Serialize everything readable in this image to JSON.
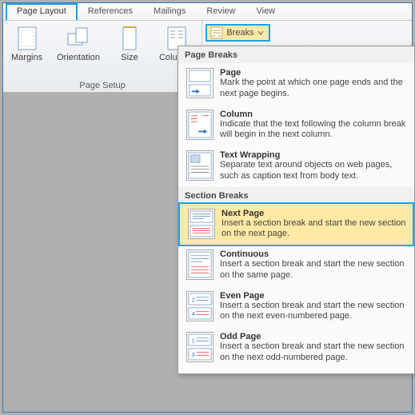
{
  "tabs": {
    "pageLayout": "Page Layout",
    "references": "References",
    "mailings": "Mailings",
    "review": "Review",
    "view": "View"
  },
  "ribbon": {
    "margins": "Margins",
    "orientation": "Orientation",
    "size": "Size",
    "columns": "Columns",
    "pageSetupGroup": "Page Setup",
    "breaks": "Breaks"
  },
  "dropdown": {
    "pageBreaksHeader": "Page Breaks",
    "sectionBreaksHeader": "Section Breaks",
    "page": {
      "title": "Page",
      "desc": "Mark the point at which one page ends and the next page begins."
    },
    "column": {
      "title": "Column",
      "desc": "Indicate that the text following the column break will begin in the next column."
    },
    "textWrapping": {
      "title": "Text Wrapping",
      "desc": "Separate text around objects on web pages, such as caption text from body text."
    },
    "nextPage": {
      "title": "Next Page",
      "desc": "Insert a section break and start the new section on the next page."
    },
    "continuous": {
      "title": "Continuous",
      "desc": "Insert a section break and start the new section on the same page."
    },
    "evenPage": {
      "title": "Even Page",
      "desc": "Insert a section break and start the new section on the next even-numbered page."
    },
    "oddPage": {
      "title": "Odd Page",
      "desc": "Insert a section break and start the new section on the next odd-numbered page."
    }
  }
}
